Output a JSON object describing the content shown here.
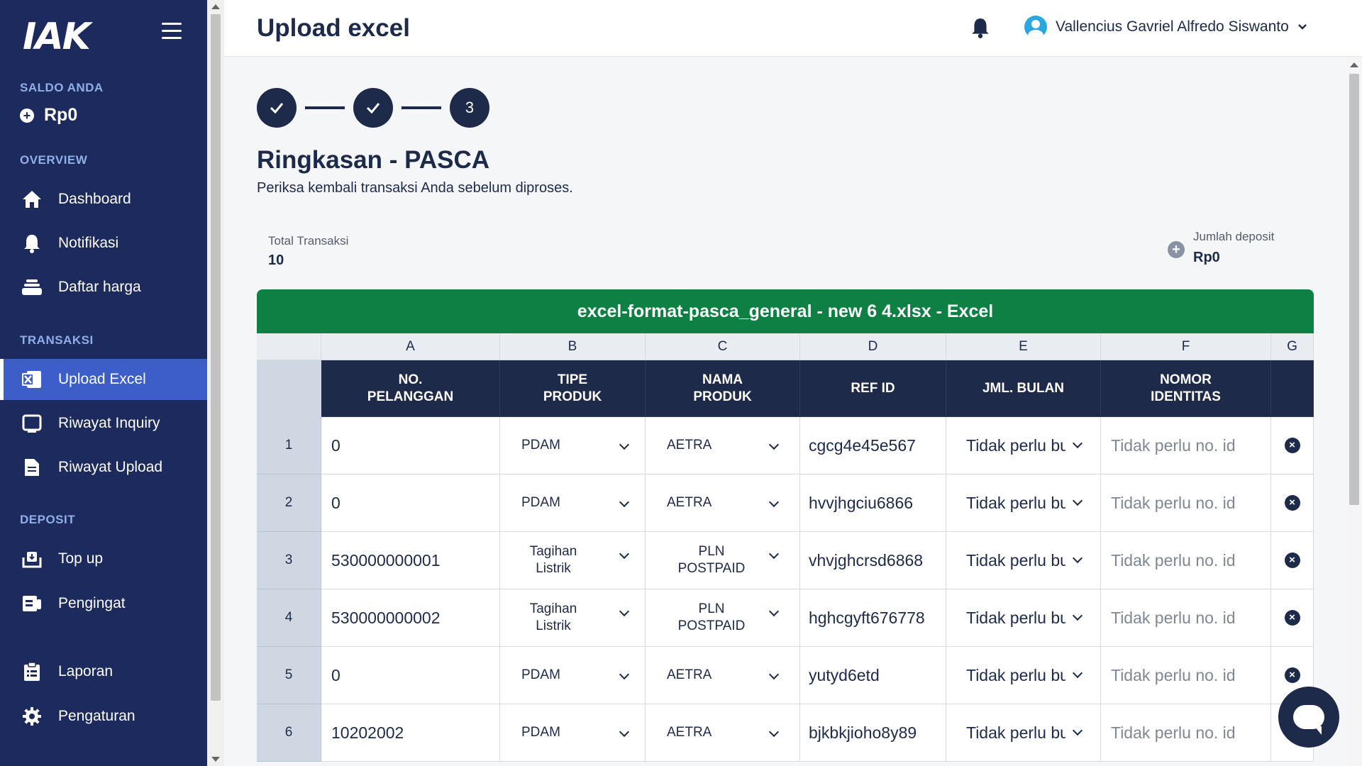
{
  "brand": {
    "logo_text": "IAK"
  },
  "sidebar": {
    "saldo_label": "SALDO ANDA",
    "saldo_value": "Rp0",
    "overview_label": "OVERVIEW",
    "transaksi_label": "TRANSAKSI",
    "deposit_label": "DEPOSIT",
    "items": [
      {
        "label": "Dashboard",
        "icon": "home-icon"
      },
      {
        "label": "Notifikasi",
        "icon": "bell-icon"
      },
      {
        "label": "Daftar harga",
        "icon": "stack-icon"
      },
      {
        "label": "Upload Excel",
        "icon": "excel-icon",
        "active": true
      },
      {
        "label": "Riwayat Inquiry",
        "icon": "monitor-icon"
      },
      {
        "label": "Riwayat Upload",
        "icon": "document-icon"
      },
      {
        "label": "Top up",
        "icon": "topup-icon"
      },
      {
        "label": "Pengingat",
        "icon": "reminder-icon"
      },
      {
        "label": "Laporan",
        "icon": "clipboard-icon"
      },
      {
        "label": "Pengaturan",
        "icon": "gear-icon"
      }
    ]
  },
  "header": {
    "title": "Upload excel",
    "user_name": "Vallencius Gavriel Alfredo Siswanto"
  },
  "stepper": {
    "step3_label": "3"
  },
  "summary": {
    "title": "Ringkasan - PASCA",
    "subtitle": "Periksa kembali transaksi Anda sebelum diproses.",
    "total_label": "Total Transaksi",
    "total_value": "10",
    "deposit_label": "Jumlah deposit",
    "deposit_value": "Rp0"
  },
  "file_banner": "excel-format-pasca_general - new 6 4.xlsx - Excel",
  "table": {
    "column_letters": [
      "A",
      "B",
      "C",
      "D",
      "E",
      "F",
      "G"
    ],
    "headers": {
      "no_pelanggan_1": "NO.",
      "no_pelanggan_2": "PELANGGAN",
      "tipe_1": "TIPE",
      "tipe_2": "PRODUK",
      "nama_1": "NAMA",
      "nama_2": "PRODUK",
      "ref": "REF ID",
      "bulan": "JML. BULAN",
      "identitas_1": "NOMOR",
      "identitas_2": "IDENTITAS"
    },
    "rows": [
      {
        "num": "1",
        "no_pelanggan": "0",
        "tipe_1": "PDAM",
        "tipe_2": "",
        "nama_1": "AETRA",
        "nama_2": "",
        "ref_id": "cgcg4e45e567",
        "jml_bulan": "Tidak perlu bulan",
        "identitas": "Tidak perlu no. id"
      },
      {
        "num": "2",
        "no_pelanggan": "0",
        "tipe_1": "PDAM",
        "tipe_2": "",
        "nama_1": "AETRA",
        "nama_2": "",
        "ref_id": "hvvjhgciu6866",
        "jml_bulan": "Tidak perlu bulan",
        "identitas": "Tidak perlu no. id"
      },
      {
        "num": "3",
        "no_pelanggan": "530000000001",
        "tipe_1": "Tagihan",
        "tipe_2": "Listrik",
        "nama_1": "PLN",
        "nama_2": "POSTPAID",
        "ref_id": "vhvjghcrsd6868",
        "jml_bulan": "Tidak perlu bulan",
        "identitas": "Tidak perlu no. id"
      },
      {
        "num": "4",
        "no_pelanggan": "530000000002",
        "tipe_1": "Tagihan",
        "tipe_2": "Listrik",
        "nama_1": "PLN",
        "nama_2": "POSTPAID",
        "ref_id": "hghcgyft676778",
        "jml_bulan": "Tidak perlu bulan",
        "identitas": "Tidak perlu no. id"
      },
      {
        "num": "5",
        "no_pelanggan": "0",
        "tipe_1": "PDAM",
        "tipe_2": "",
        "nama_1": "AETRA",
        "nama_2": "",
        "ref_id": "yutyd6etd",
        "jml_bulan": "Tidak perlu bulan",
        "identitas": "Tidak perlu no. id"
      },
      {
        "num": "6",
        "no_pelanggan": "10202002",
        "tipe_1": "PDAM",
        "tipe_2": "",
        "nama_1": "AETRA",
        "nama_2": "",
        "ref_id": "bjkbkjioho8y89",
        "jml_bulan": "Tidak perlu bulan",
        "identitas": "Tidak perlu no. id"
      }
    ]
  },
  "colors": {
    "sidebar": "#1d2a5e",
    "active": "#3d5ec9",
    "banner": "#0e8043",
    "navy": "#1d2a4a"
  }
}
